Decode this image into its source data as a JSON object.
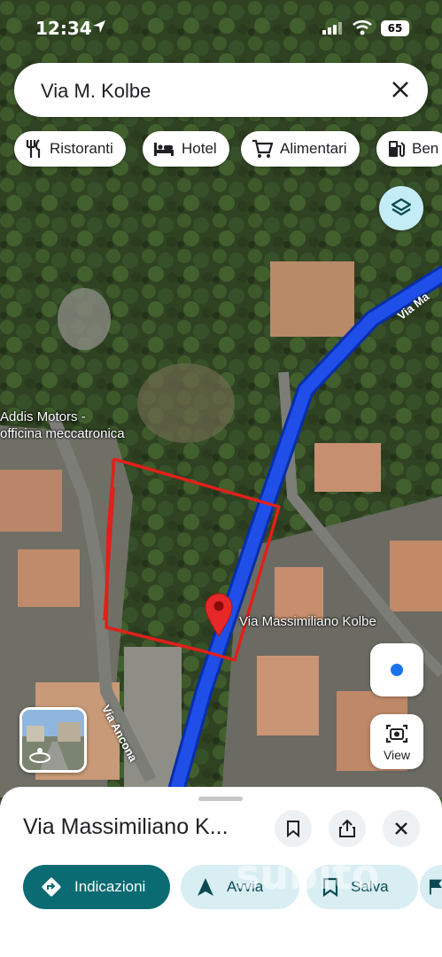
{
  "status_bar": {
    "time": "12:34",
    "battery": "65"
  },
  "search": {
    "query": "Via M. Kolbe"
  },
  "chips": [
    {
      "label": "Ristoranti",
      "icon": "fork-knife-icon"
    },
    {
      "label": "Hotel",
      "icon": "bed-icon"
    },
    {
      "label": "Alimentari",
      "icon": "cart-icon"
    },
    {
      "label": "Ben",
      "icon": "gas-station-icon"
    }
  ],
  "map": {
    "poi_label_line1": "Addis Motors -",
    "poi_label_line2": "officina meccatronica",
    "pin_label": "Via Massimiliano Kolbe",
    "street_top": "Via Ma",
    "street_ancona": "Via Ancona",
    "route_color": "#1f4fe8",
    "annotation_color": "#e0201a"
  },
  "controls": {
    "view_label": "View"
  },
  "sheet": {
    "title": "Via Massimiliano K...",
    "actions": [
      {
        "label": "Indicazioni",
        "icon": "directions-icon"
      },
      {
        "label": "Avvia",
        "icon": "navigation-arrow-icon"
      },
      {
        "label": "Salva",
        "icon": "bookmark-icon"
      }
    ]
  },
  "watermark": "subito"
}
